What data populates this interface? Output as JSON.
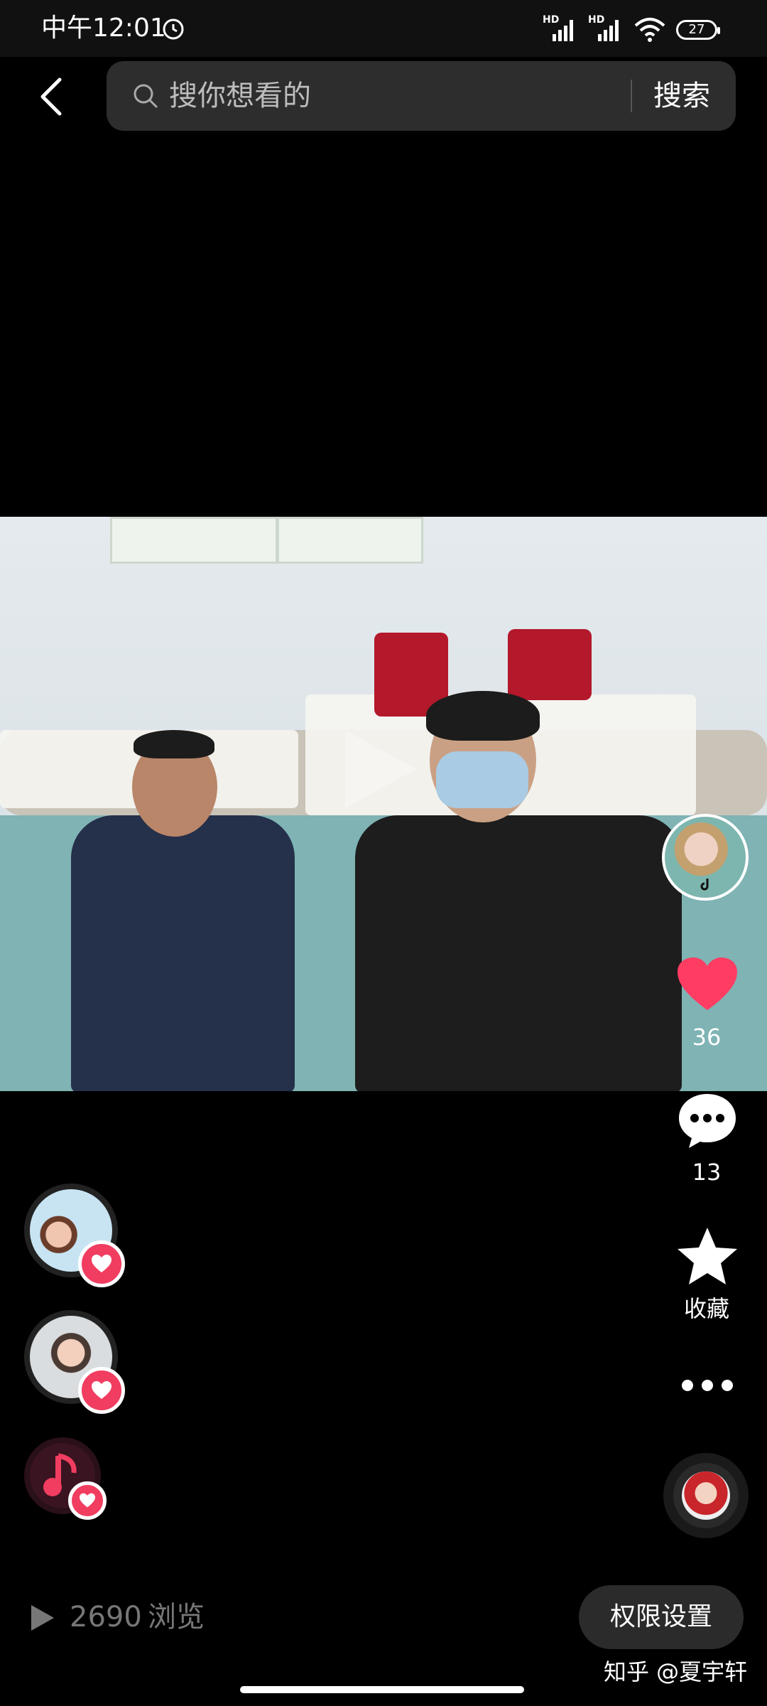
{
  "status_bar": {
    "time": "中午12:01",
    "signal_1_label": "HD",
    "signal_2_label": "HD",
    "battery": "27"
  },
  "top_bar": {
    "search_placeholder": "搜你想看的",
    "search_button": "搜索"
  },
  "actions": {
    "like_count": "36",
    "comment_count": "13",
    "favorite_label": "收藏"
  },
  "footer": {
    "views_count": "2690",
    "views_label": "浏览",
    "permission_button": "权限设置",
    "watermark": "知乎 @夏宇轩"
  },
  "colors": {
    "accent_pink": "#f03d60",
    "like_red": "#ff3d63",
    "background": "#000000"
  }
}
